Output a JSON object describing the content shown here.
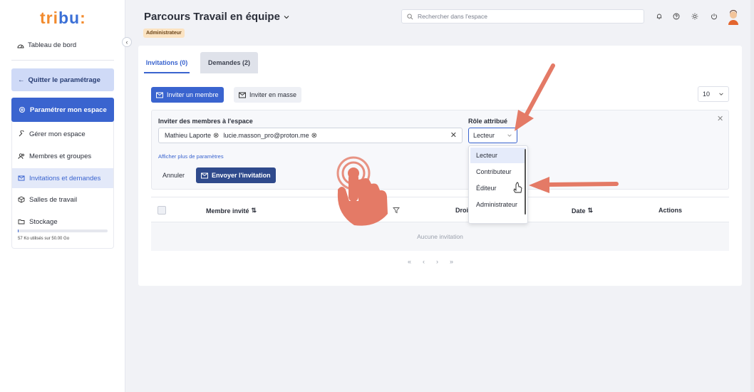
{
  "sidebar": {
    "logo": {
      "part1": "tri",
      "part2": "bu",
      "suffix": ":"
    },
    "home": "Tableau de bord",
    "quit": "Quitter le paramétrage",
    "config": "Paramétrer mon espace",
    "items": [
      {
        "label": "Gérer mon espace",
        "icon": "wrench-icon"
      },
      {
        "label": "Membres et groupes",
        "icon": "users-icon"
      },
      {
        "label": "Invitations et demandes",
        "icon": "mail-icon"
      },
      {
        "label": "Salles de travail",
        "icon": "box-icon"
      },
      {
        "label": "Stockage",
        "icon": "folder-icon"
      }
    ],
    "storage_text": "57 Ko utilisés sur 50.00 Go",
    "storage_fraction": 0.001
  },
  "header": {
    "title": "Parcours Travail en équipe",
    "role_badge": "Administrateur",
    "search_placeholder": "Rechercher dans l'espace"
  },
  "tabs": [
    {
      "label": "Invitations (0)",
      "active": true
    },
    {
      "label": "Demandes (2)",
      "active": false
    }
  ],
  "toolbar": {
    "invite_member": "Inviter un membre",
    "invite_bulk": "Inviter en masse",
    "page_size": "10"
  },
  "form": {
    "members_label": "Inviter des membres à l'espace",
    "tags": [
      "Mathieu Laporte",
      "lucie.masson_pro@proton.me"
    ],
    "role_label": "Rôle attribué",
    "role_value": "Lecteur",
    "more_params": "Afficher plus de paramètres",
    "cancel": "Annuler",
    "send": "Envoyer l'invitation"
  },
  "role_dropdown": {
    "options": [
      "Lecteur",
      "Contributeur",
      "Éditeur",
      "Administrateur"
    ],
    "selected": "Lecteur",
    "hovered": "Éditeur"
  },
  "table": {
    "columns": [
      "Membre invité",
      "t",
      "Droi",
      "Date",
      "Actions"
    ],
    "empty": "Aucune invitation",
    "pager": [
      "«",
      "‹",
      "›",
      "»"
    ]
  },
  "colors": {
    "accent": "#3a64cf",
    "annotation_arrow": "#e47a66",
    "role_badge_bg": "#fbe3c2"
  }
}
